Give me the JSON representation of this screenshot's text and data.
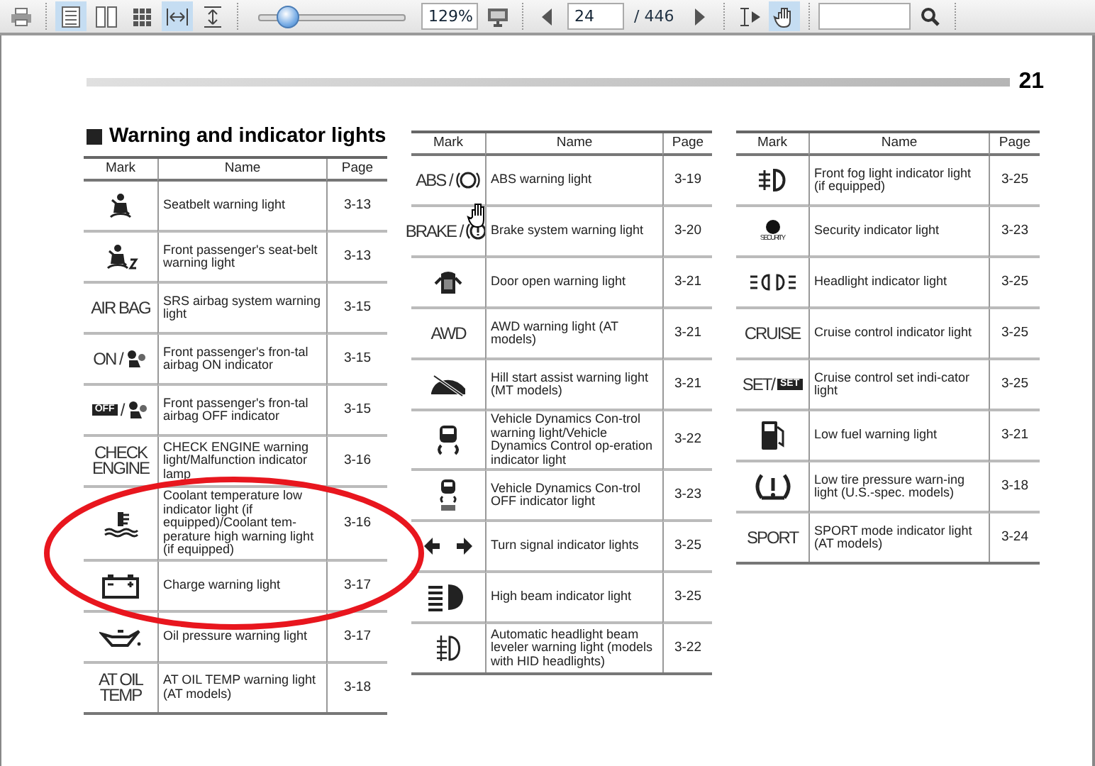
{
  "toolbar": {
    "layout_modes": [
      {
        "selected": true
      },
      {
        "selected": false
      },
      {
        "selected": false
      }
    ],
    "fit_modes": [
      {
        "selected": true
      },
      {
        "selected": false
      }
    ],
    "zoom": {
      "level": 0.19,
      "value": "129%"
    },
    "page": {
      "value": "24",
      "total": "/ 446"
    },
    "tools": [
      {
        "selected": false
      },
      {
        "selected": true
      }
    ]
  },
  "document": {
    "page_number": "21",
    "heading": "Warning and indicator lights",
    "tables": [
      {
        "columns": [
          "Mark",
          "Name",
          "Page"
        ],
        "rows": [
          {
            "mark": {
              "kind": "icon"
            },
            "name": "Seatbelt warning light",
            "page": "3-13"
          },
          {
            "mark": {
              "kind": "icon"
            },
            "name": "Front passenger's seat-belt warning light",
            "page": "3-13"
          },
          {
            "mark": {
              "kind": "text",
              "lines": [
                "AIR BAG"
              ]
            },
            "name": "SRS airbag system warning light",
            "page": "3-15"
          },
          {
            "mark": {
              "kind": "text_icon",
              "text": "ON /"
            },
            "name": "Front passenger's fron-tal airbag ON indicator",
            "page": "3-15"
          },
          {
            "mark": {
              "kind": "boxed_icon",
              "box": "OFF",
              "text": "/"
            },
            "name": "Front passenger's fron-tal airbag OFF indicator",
            "page": "3-15"
          },
          {
            "mark": {
              "kind": "text",
              "lines": [
                "CHECK",
                "ENGINE"
              ]
            },
            "name": "CHECK ENGINE warning light/Malfunction indicator lamp",
            "page": "3-16"
          },
          {
            "mark": {
              "kind": "icon"
            },
            "name": "Coolant temperature low indicator light (if equipped)/Coolant tem-perature high warning light (if equipped)",
            "page": "3-16"
          },
          {
            "mark": {
              "kind": "icon"
            },
            "name": "Charge warning light",
            "page": "3-17"
          },
          {
            "mark": {
              "kind": "icon"
            },
            "name": "Oil pressure warning light",
            "page": "3-17"
          },
          {
            "mark": {
              "kind": "text",
              "lines": [
                "AT OIL",
                "TEMP"
              ]
            },
            "name": "AT OIL TEMP warning light (AT models)",
            "page": "3-18"
          }
        ]
      },
      {
        "columns": [
          "Mark",
          "Name",
          "Page"
        ],
        "rows": [
          {
            "mark": {
              "kind": "text_icon",
              "text": "ABS /"
            },
            "name": "ABS warning light",
            "page": "3-19"
          },
          {
            "mark": {
              "kind": "text_icon",
              "text": "BRAKE /"
            },
            "name": "Brake system warning light",
            "page": "3-20"
          },
          {
            "mark": {
              "kind": "icon"
            },
            "name": "Door open warning light",
            "page": "3-21"
          },
          {
            "mark": {
              "kind": "text",
              "lines": [
                "AWD"
              ]
            },
            "name": "AWD warning light (AT models)",
            "page": "3-21"
          },
          {
            "mark": {
              "kind": "icon"
            },
            "name": "Hill start assist warning light (MT models)",
            "page": "3-21"
          },
          {
            "mark": {
              "kind": "icon"
            },
            "name": "Vehicle Dynamics Con-trol warning light/Vehicle Dynamics Control op-eration indicator light",
            "page": "3-22"
          },
          {
            "mark": {
              "kind": "icon"
            },
            "name": "Vehicle Dynamics Con-trol OFF indicator light",
            "page": "3-23"
          },
          {
            "mark": {
              "kind": "icon"
            },
            "name": "Turn signal indicator lights",
            "page": "3-25"
          },
          {
            "mark": {
              "kind": "icon"
            },
            "name": "High beam indicator light",
            "page": "3-25"
          },
          {
            "mark": {
              "kind": "icon"
            },
            "name": "Automatic headlight beam leveler warning light (models with HID headlights)",
            "page": "3-22"
          }
        ]
      },
      {
        "columns": [
          "Mark",
          "Name",
          "Page"
        ],
        "rows": [
          {
            "mark": {
              "kind": "icon"
            },
            "name": "Front fog light indicator light (if equipped)",
            "page": "3-25"
          },
          {
            "mark": {
              "kind": "icon_text",
              "text": "SECURITY"
            },
            "name": "Security indicator light",
            "page": "3-23"
          },
          {
            "mark": {
              "kind": "icon"
            },
            "name": "Headlight indicator light",
            "page": "3-25"
          },
          {
            "mark": {
              "kind": "text",
              "lines": [
                "CRUISE"
              ]
            },
            "name": "Cruise control indicator light",
            "page": "3-25"
          },
          {
            "mark": {
              "kind": "text_boxed",
              "text": "SET/",
              "box": "SET"
            },
            "name": "Cruise control set indi-cator light",
            "page": "3-25"
          },
          {
            "mark": {
              "kind": "icon"
            },
            "name": "Low fuel warning light",
            "page": "3-21"
          },
          {
            "mark": {
              "kind": "icon"
            },
            "name": "Low tire pressure warn-ing light (U.S.-spec. models)",
            "page": "3-18"
          },
          {
            "mark": {
              "kind": "text",
              "lines": [
                "SPORT"
              ]
            },
            "name": "SPORT mode indicator light (AT models)",
            "page": "3-24"
          }
        ]
      }
    ]
  }
}
